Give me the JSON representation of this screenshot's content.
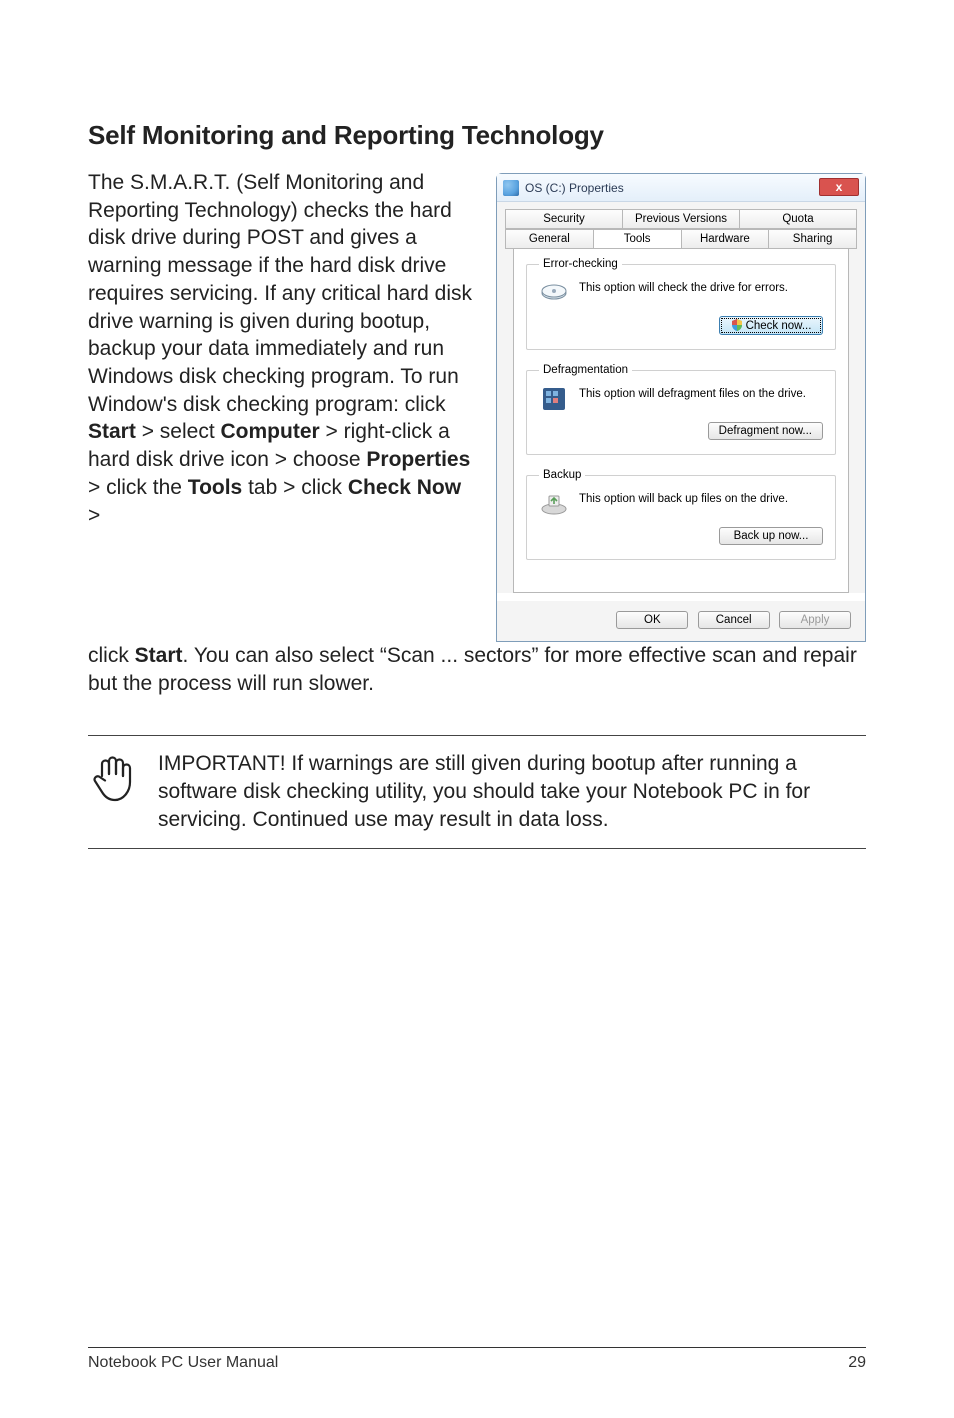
{
  "heading": "Self Monitoring and Reporting Technology",
  "para_seg": [
    "The S.M.A.R.T. (Self Monitoring and Reporting Technology) checks the hard disk drive during POST and gives a warning message if the hard disk drive requires servicing. If any critical hard disk drive warning is given during bootup, backup your data immediately and run Windows disk checking program. To run Window's disk checking program: click ",
    "Start",
    " > select ",
    "Computer",
    " > right-click a hard disk drive icon > choose ",
    "Properties",
    " > click the ",
    "Tools",
    " tab > click ",
    "Check Now",
    " > "
  ],
  "para_after": [
    "click ",
    "Start",
    ". You can also select “Scan ... sectors” for more effective scan and repair but the process will run slower."
  ],
  "dialog": {
    "title": "OS (C:) Properties",
    "close": "x",
    "tabs_row1": [
      "Security",
      "Previous Versions",
      "Quota"
    ],
    "tabs_row2": [
      "General",
      "Tools",
      "Hardware",
      "Sharing"
    ],
    "groups": {
      "error": {
        "legend": "Error-checking",
        "text": "This option will check the drive for errors.",
        "button": "Check now..."
      },
      "defrag": {
        "legend": "Defragmentation",
        "text": "This option will defragment files on the drive.",
        "button": "Defragment now..."
      },
      "backup": {
        "legend": "Backup",
        "text": "This option will back up files on the drive.",
        "button": "Back up now..."
      }
    },
    "footer": {
      "ok": "OK",
      "cancel": "Cancel",
      "apply": "Apply"
    }
  },
  "note": "IMPORTANT! If warnings are still given during bootup after running a software disk checking utility, you should take your Notebook PC in for servicing. Continued use may result in data loss.",
  "footer_left": "Notebook PC User Manual",
  "footer_right": "29"
}
